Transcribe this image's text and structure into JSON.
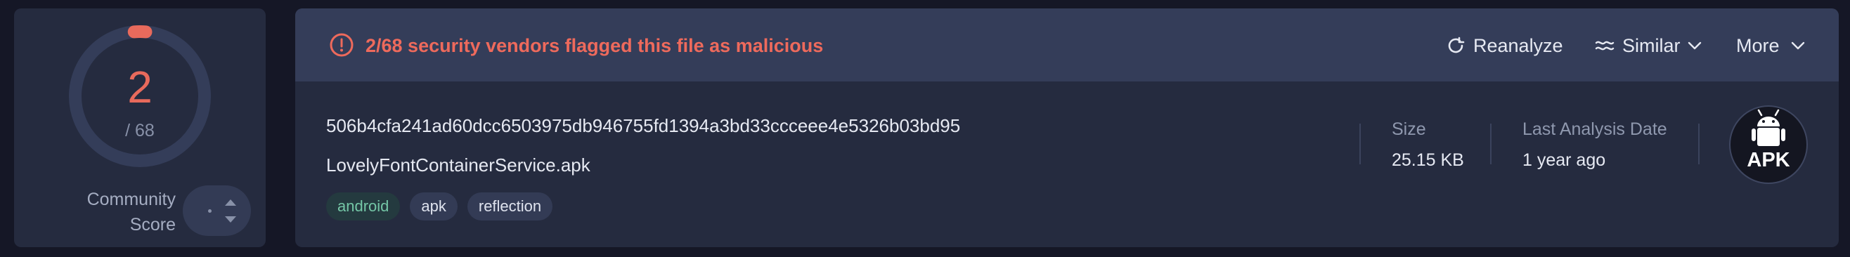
{
  "score": {
    "detections": "2",
    "total": "/ 68",
    "detections_count": 2,
    "total_count": 68,
    "accent_color": "#e86a5c",
    "community_label_1": "Community",
    "community_label_2": "Score"
  },
  "banner": {
    "alert_text": "2/68 security vendors flagged this file as malicious",
    "reanalyze_label": "Reanalyze",
    "similar_label": "Similar",
    "more_label": "More",
    "alert_color": "#ee6a5c"
  },
  "file": {
    "hash": "506b4cfa241ad60dcc6503975db946755fd1394a3bd33ccceee4e5326b03bd95",
    "name": "LovelyFontContainerService.apk",
    "tags": [
      "android",
      "apk",
      "reflection"
    ]
  },
  "meta": {
    "size_label": "Size",
    "size_value": "25.15 KB",
    "date_label": "Last Analysis Date",
    "date_value": "1 year ago"
  },
  "file_type_badge": {
    "label": "APK",
    "icon": "android-icon"
  }
}
